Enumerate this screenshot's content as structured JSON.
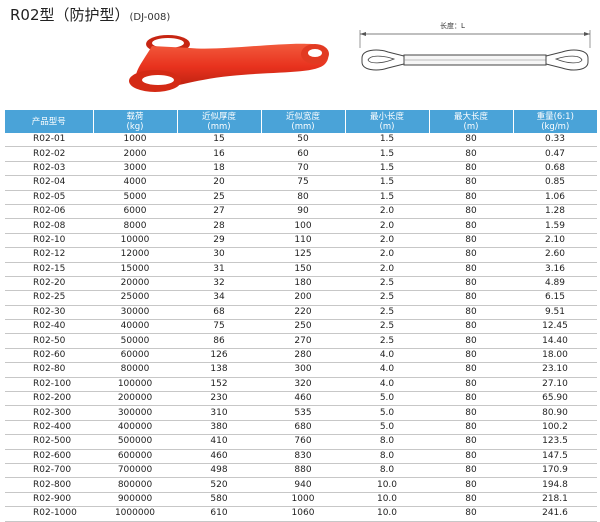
{
  "header": {
    "code": "R02型",
    "type": "（防护型）",
    "standard": "(DJ-008)"
  },
  "diagram": {
    "length_label": "长度：L"
  },
  "colors": {
    "header_bg": "#4aa3d8",
    "sling_red": "#e8321e",
    "row_line": "#c7c7c7"
  },
  "table": {
    "headers": [
      {
        "l1": "产品型号",
        "l2": ""
      },
      {
        "l1": "载荷",
        "l2": "(kg)"
      },
      {
        "l1": "近似厚度",
        "l2": "(mm)"
      },
      {
        "l1": "近似宽度",
        "l2": "(mm)"
      },
      {
        "l1": "最小长度",
        "l2": "(m)"
      },
      {
        "l1": "最大长度",
        "l2": "(m)"
      },
      {
        "l1": "重量(6:1)",
        "l2": "(kg/m)"
      }
    ],
    "rows": [
      [
        "R02-01",
        "1000",
        "15",
        "50",
        "1.5",
        "80",
        "0.33"
      ],
      [
        "R02-02",
        "2000",
        "16",
        "60",
        "1.5",
        "80",
        "0.47"
      ],
      [
        "R02-03",
        "3000",
        "18",
        "70",
        "1.5",
        "80",
        "0.68"
      ],
      [
        "R02-04",
        "4000",
        "20",
        "75",
        "1.5",
        "80",
        "0.85"
      ],
      [
        "R02-05",
        "5000",
        "25",
        "80",
        "1.5",
        "80",
        "1.06"
      ],
      [
        "R02-06",
        "6000",
        "27",
        "90",
        "2.0",
        "80",
        "1.28"
      ],
      [
        "R02-08",
        "8000",
        "28",
        "100",
        "2.0",
        "80",
        "1.59"
      ],
      [
        "R02-10",
        "10000",
        "29",
        "110",
        "2.0",
        "80",
        "2.10"
      ],
      [
        "R02-12",
        "12000",
        "30",
        "125",
        "2.0",
        "80",
        "2.60"
      ],
      [
        "R02-15",
        "15000",
        "31",
        "150",
        "2.0",
        "80",
        "3.16"
      ],
      [
        "R02-20",
        "20000",
        "32",
        "180",
        "2.5",
        "80",
        "4.89"
      ],
      [
        "R02-25",
        "25000",
        "34",
        "200",
        "2.5",
        "80",
        "6.15"
      ],
      [
        "R02-30",
        "30000",
        "68",
        "220",
        "2.5",
        "80",
        "9.51"
      ],
      [
        "R02-40",
        "40000",
        "75",
        "250",
        "2.5",
        "80",
        "12.45"
      ],
      [
        "R02-50",
        "50000",
        "86",
        "270",
        "2.5",
        "80",
        "14.40"
      ],
      [
        "R02-60",
        "60000",
        "126",
        "280",
        "4.0",
        "80",
        "18.00"
      ],
      [
        "R02-80",
        "80000",
        "138",
        "300",
        "4.0",
        "80",
        "23.10"
      ],
      [
        "R02-100",
        "100000",
        "152",
        "320",
        "4.0",
        "80",
        "27.10"
      ],
      [
        "R02-200",
        "200000",
        "230",
        "460",
        "5.0",
        "80",
        "65.90"
      ],
      [
        "R02-300",
        "300000",
        "310",
        "535",
        "5.0",
        "80",
        "80.90"
      ],
      [
        "R02-400",
        "400000",
        "380",
        "680",
        "5.0",
        "80",
        "100.2"
      ],
      [
        "R02-500",
        "500000",
        "410",
        "760",
        "8.0",
        "80",
        "123.5"
      ],
      [
        "R02-600",
        "600000",
        "460",
        "830",
        "8.0",
        "80",
        "147.5"
      ],
      [
        "R02-700",
        "700000",
        "498",
        "880",
        "8.0",
        "80",
        "170.9"
      ],
      [
        "R02-800",
        "800000",
        "520",
        "940",
        "10.0",
        "80",
        "194.8"
      ],
      [
        "R02-900",
        "900000",
        "580",
        "1000",
        "10.0",
        "80",
        "218.1"
      ],
      [
        "R02-1000",
        "1000000",
        "610",
        "1060",
        "10.0",
        "80",
        "241.6"
      ]
    ]
  }
}
